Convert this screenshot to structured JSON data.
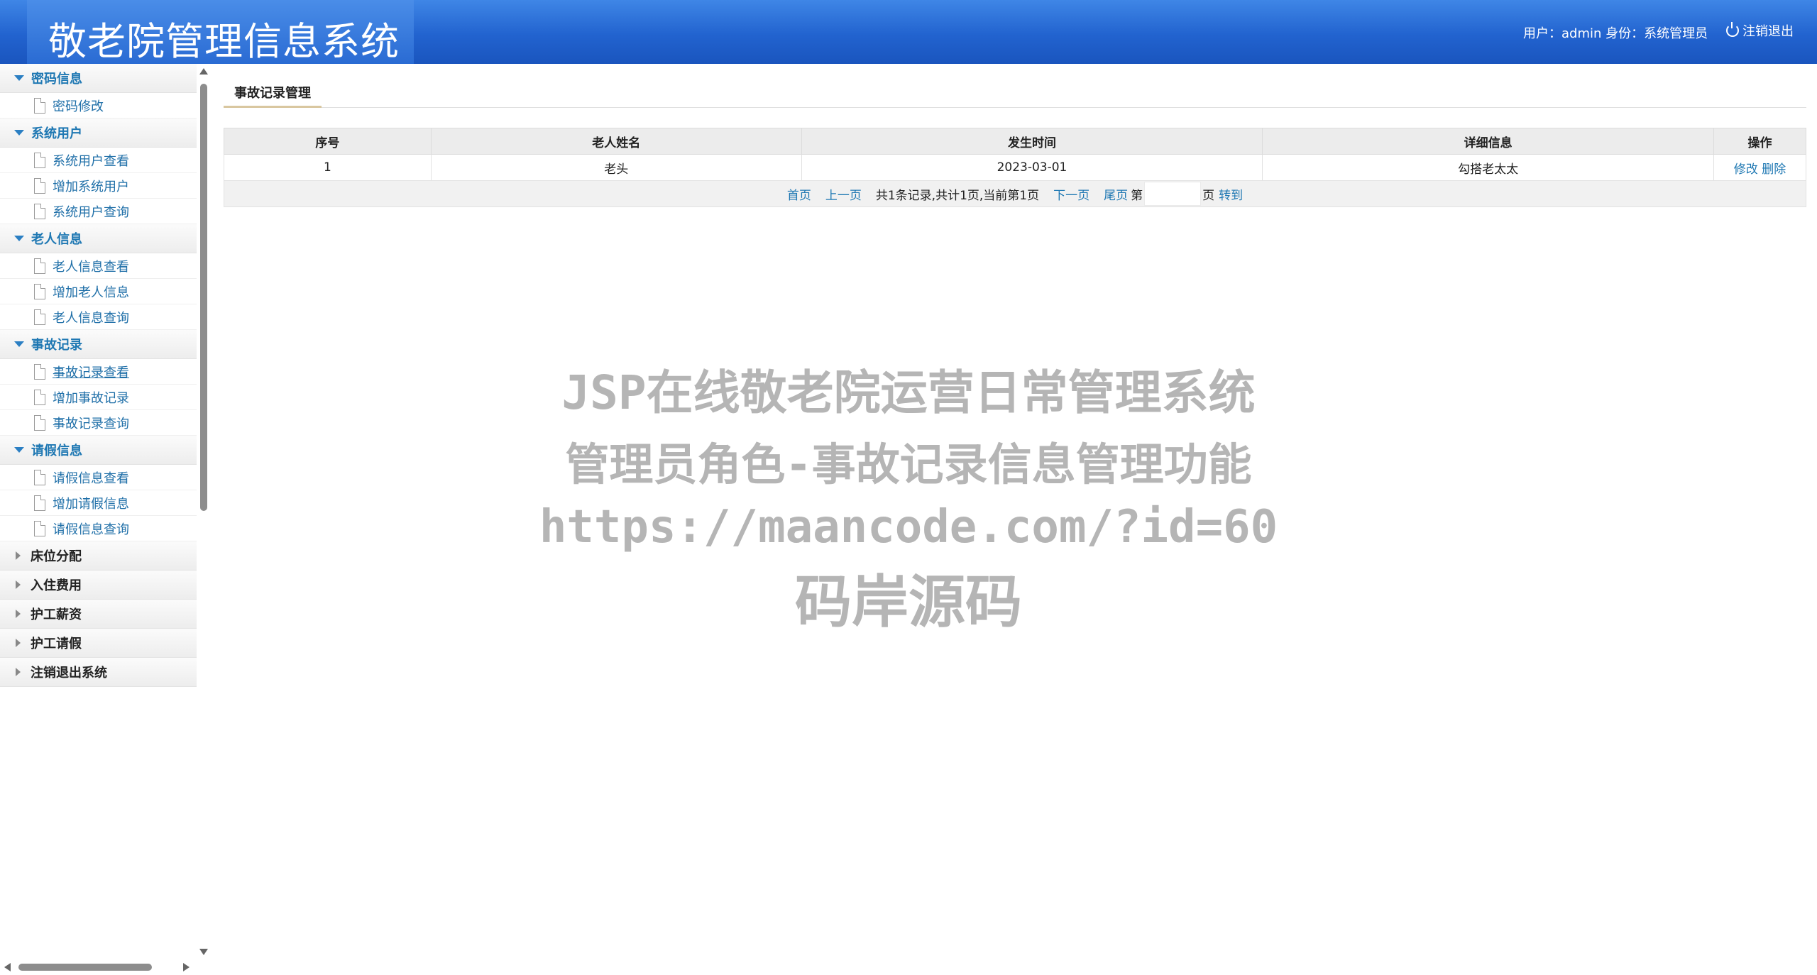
{
  "app": {
    "title": "敬老院管理信息系统",
    "user_info": "用户：admin 身份：系统管理员",
    "logout_label": "注销退出"
  },
  "sidebar": {
    "sections": [
      {
        "label": "密码信息",
        "expanded": true,
        "items": [
          "密码修改"
        ]
      },
      {
        "label": "系统用户",
        "expanded": true,
        "items": [
          "系统用户查看",
          "增加系统用户",
          "系统用户查询"
        ]
      },
      {
        "label": "老人信息",
        "expanded": true,
        "items": [
          "老人信息查看",
          "增加老人信息",
          "老人信息查询"
        ]
      },
      {
        "label": "事故记录",
        "expanded": true,
        "items": [
          "事故记录查看",
          "增加事故记录",
          "事故记录查询"
        ]
      },
      {
        "label": "请假信息",
        "expanded": true,
        "items": [
          "请假信息查看",
          "增加请假信息",
          "请假信息查询"
        ]
      },
      {
        "label": "床位分配",
        "expanded": false,
        "items": []
      },
      {
        "label": "入住费用",
        "expanded": false,
        "items": []
      },
      {
        "label": "护工薪资",
        "expanded": false,
        "items": []
      },
      {
        "label": "护工请假",
        "expanded": false,
        "items": []
      },
      {
        "label": "注销退出系统",
        "expanded": false,
        "items": []
      }
    ]
  },
  "main": {
    "tab_label": "事故记录管理",
    "table": {
      "headers": [
        "序号",
        "老人姓名",
        "发生时间",
        "详细信息",
        "操作"
      ],
      "rows": [
        {
          "index": "1",
          "name": "老头",
          "time": "2023-03-01",
          "detail": "勾搭老太太",
          "edit": "修改",
          "delete": "删除"
        }
      ]
    },
    "pager": {
      "first": "首页",
      "prev": "上一页",
      "summary": "共1条记录,共计1页,当前第1页",
      "next": "下一页",
      "last": "尾页",
      "page_prefix": "第",
      "page_suffix": "页",
      "go": "转到",
      "page_input_value": ""
    }
  },
  "watermark": {
    "line1": "JSP在线敬老院运营日常管理系统",
    "line2": "管理员角色-事故记录信息管理功能",
    "line3": "https://maancode.com/?id=60",
    "line4": "码岸源码"
  },
  "colors": {
    "header_blue": "#2263cf",
    "link_blue": "#1f78b3",
    "watermark_gray": "#b5b5b5"
  }
}
